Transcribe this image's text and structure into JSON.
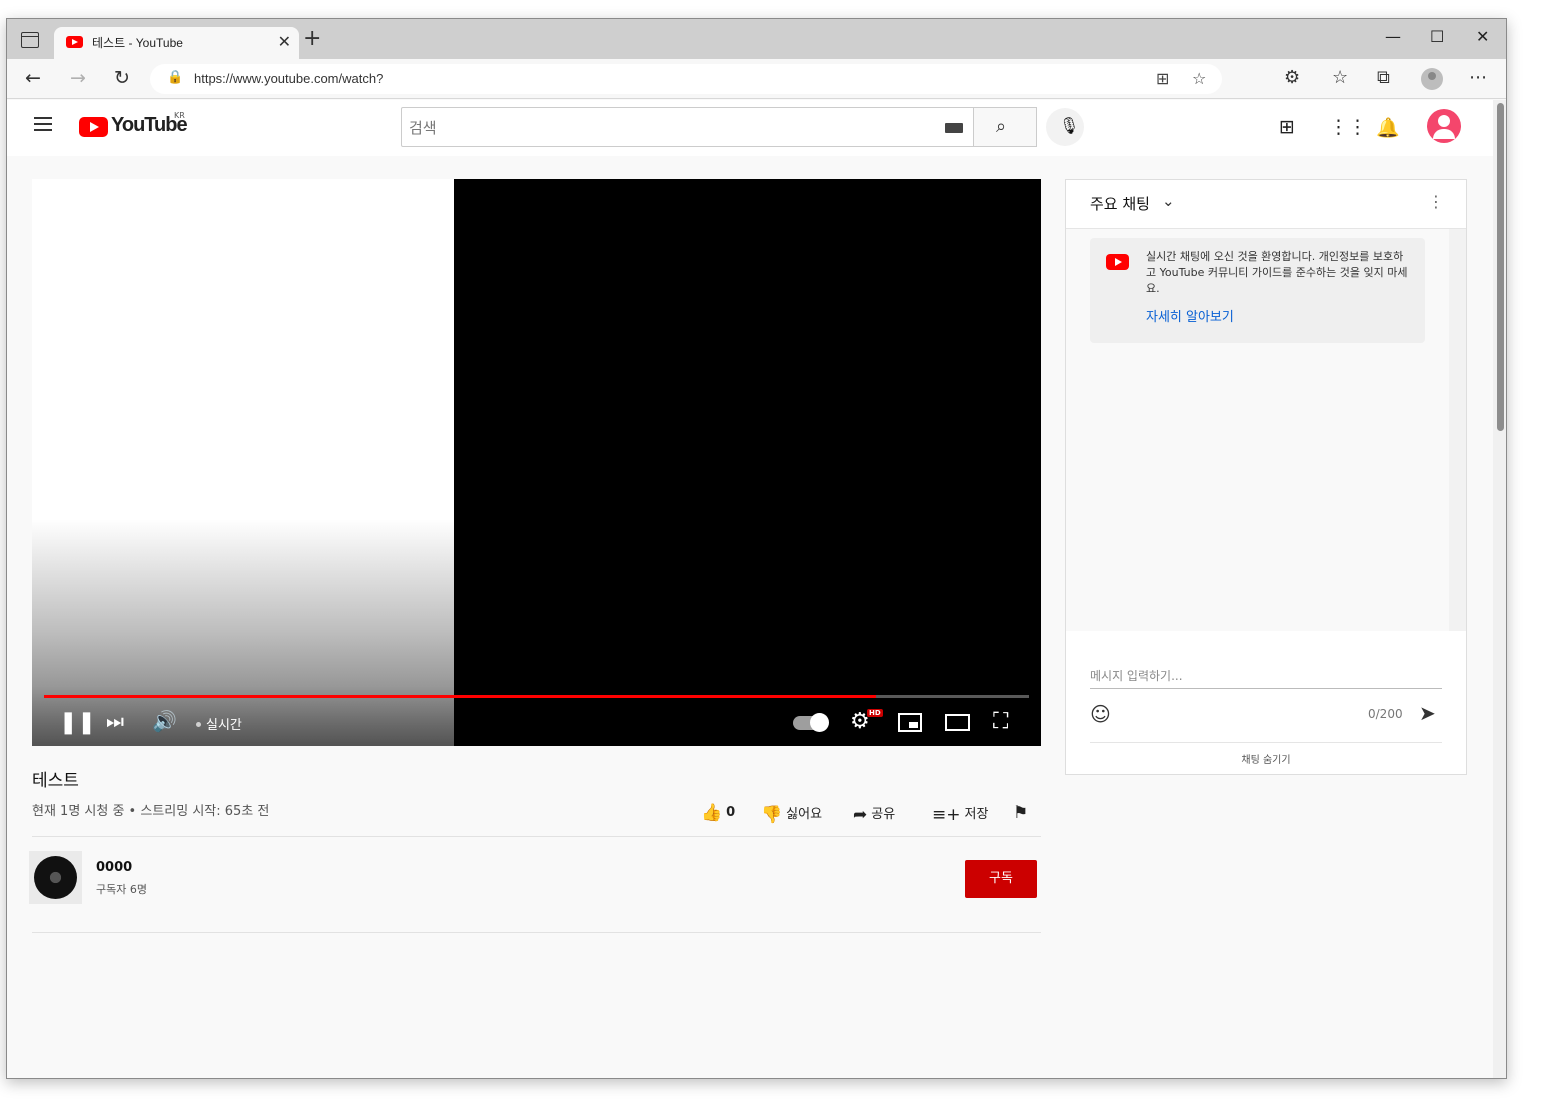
{
  "browser": {
    "tab_title": "테스트 - YouTube",
    "close_glyph": "✕",
    "new_tab_glyph": "+",
    "url": "https://www.youtube.com/watch?",
    "window_controls": [
      "—",
      "☐",
      "✕"
    ]
  },
  "header": {
    "logo_text": "YouTube",
    "region": "KR",
    "search_placeholder": "검색"
  },
  "player": {
    "live_label": "실시간",
    "progress_fraction": 0.845,
    "progress_color": "#ff0000"
  },
  "video": {
    "title": "테스트",
    "meta": "현재 1명 시청 중 • 스트리밍 시작: 65초 전",
    "likes": "0",
    "dislike_label": "싫어요",
    "share_label": "공유",
    "save_label": "저장"
  },
  "channel": {
    "name": "0000",
    "subscribers": "구독자 6명",
    "subscribe_label": "구독"
  },
  "chat": {
    "title": "주요 채팅",
    "welcome_text": "실시간 채팅에 오신 것을 환영합니다. 개인정보를 보호하고 YouTube 커뮤니티 가이드를 준수하는 것을 잊지 마세요.",
    "learn_more": "자세히 알아보기",
    "input_placeholder": "메시지 입력하기...",
    "char_count": "0/200",
    "hide_chat": "채팅 숨기기"
  },
  "colors": {
    "brand_red": "#ff0000",
    "subscribe_red": "#cc0000",
    "link_blue": "#065fd4"
  },
  "icons": [
    "tab-actions-icon",
    "youtube-favicon",
    "back-icon",
    "forward-icon",
    "refresh-icon",
    "lock-icon",
    "reader-icon",
    "favorite-add-icon",
    "extensions-icon",
    "favorites-icon",
    "collections-icon",
    "profile-icon",
    "more-icon",
    "menu-icon",
    "keyboard-icon",
    "search-icon",
    "mic-icon",
    "create-icon",
    "apps-icon",
    "bell-icon",
    "pause-icon",
    "next-icon",
    "volume-icon",
    "settings-icon",
    "miniplayer-icon",
    "theater-icon",
    "fullscreen-icon",
    "like-icon",
    "dislike-icon",
    "share-icon",
    "save-icon",
    "flag-icon",
    "emoji-icon",
    "send-icon"
  ]
}
